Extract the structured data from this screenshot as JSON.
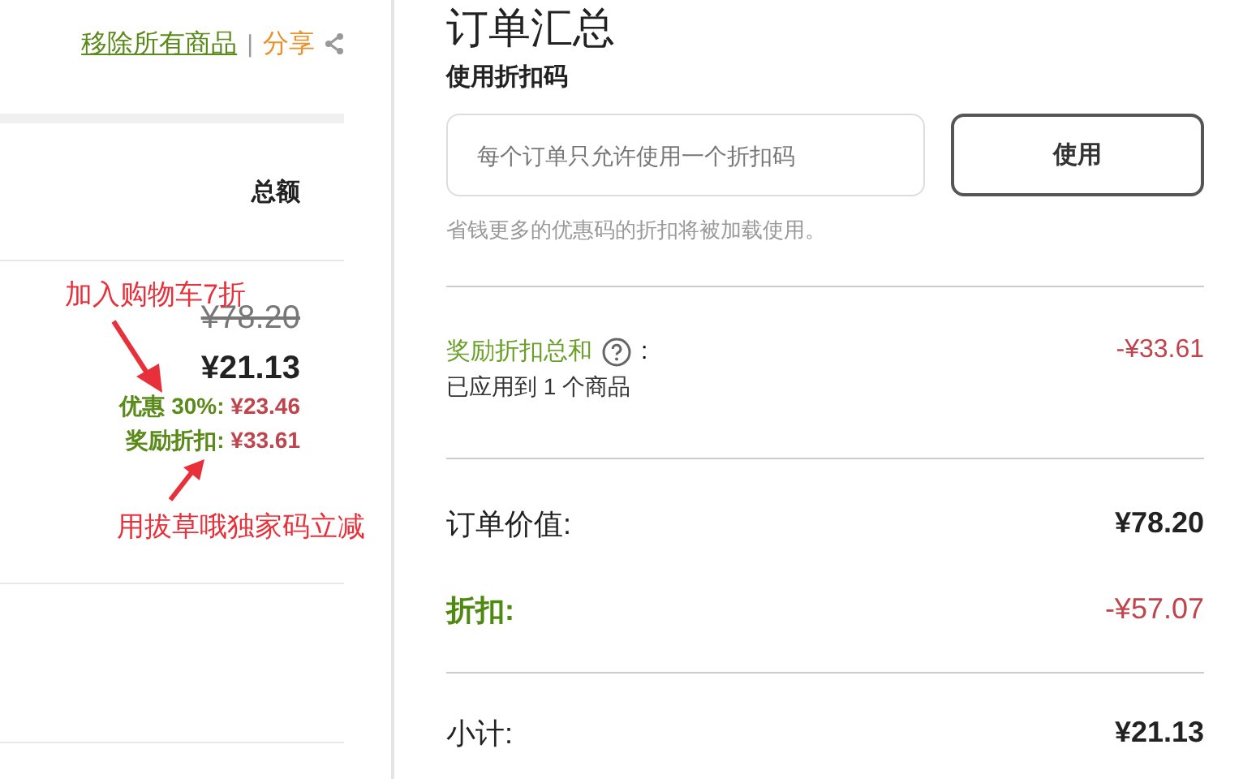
{
  "cart": {
    "remove_all": "移除所有商品",
    "separator": "|",
    "share": "分享",
    "column_header": "总额",
    "item": {
      "original_price": "¥78.20",
      "price": "¥21.13",
      "discounts": [
        {
          "label": "优惠 30%:",
          "amount": "¥23.46"
        },
        {
          "label": "奖励折扣:",
          "amount": "¥33.61"
        }
      ]
    }
  },
  "annotations": [
    {
      "text": "加入购物车7折"
    },
    {
      "text": "用拔草哦独家码立减"
    }
  ],
  "summary": {
    "title": "订单汇总",
    "coupon_label": "使用折扣码",
    "coupon_field": {
      "placeholder": "每个订单只允许使用一个折扣码"
    },
    "apply_button": "使用",
    "coupon_hint": "省钱更多的优惠码的折扣将被加载使用。",
    "reward": {
      "label": "奖励折扣总和",
      "colon": ":",
      "sub": "已应用到 1 个商品",
      "amount": "-¥33.61"
    },
    "rows": [
      {
        "kind": "plain",
        "label": "订单价值:",
        "value": "¥78.20"
      },
      {
        "kind": "discount",
        "label": "折扣:",
        "value": "-¥57.07"
      },
      {
        "kind": "plain",
        "label": "小计:",
        "value": "¥21.13"
      }
    ]
  }
}
